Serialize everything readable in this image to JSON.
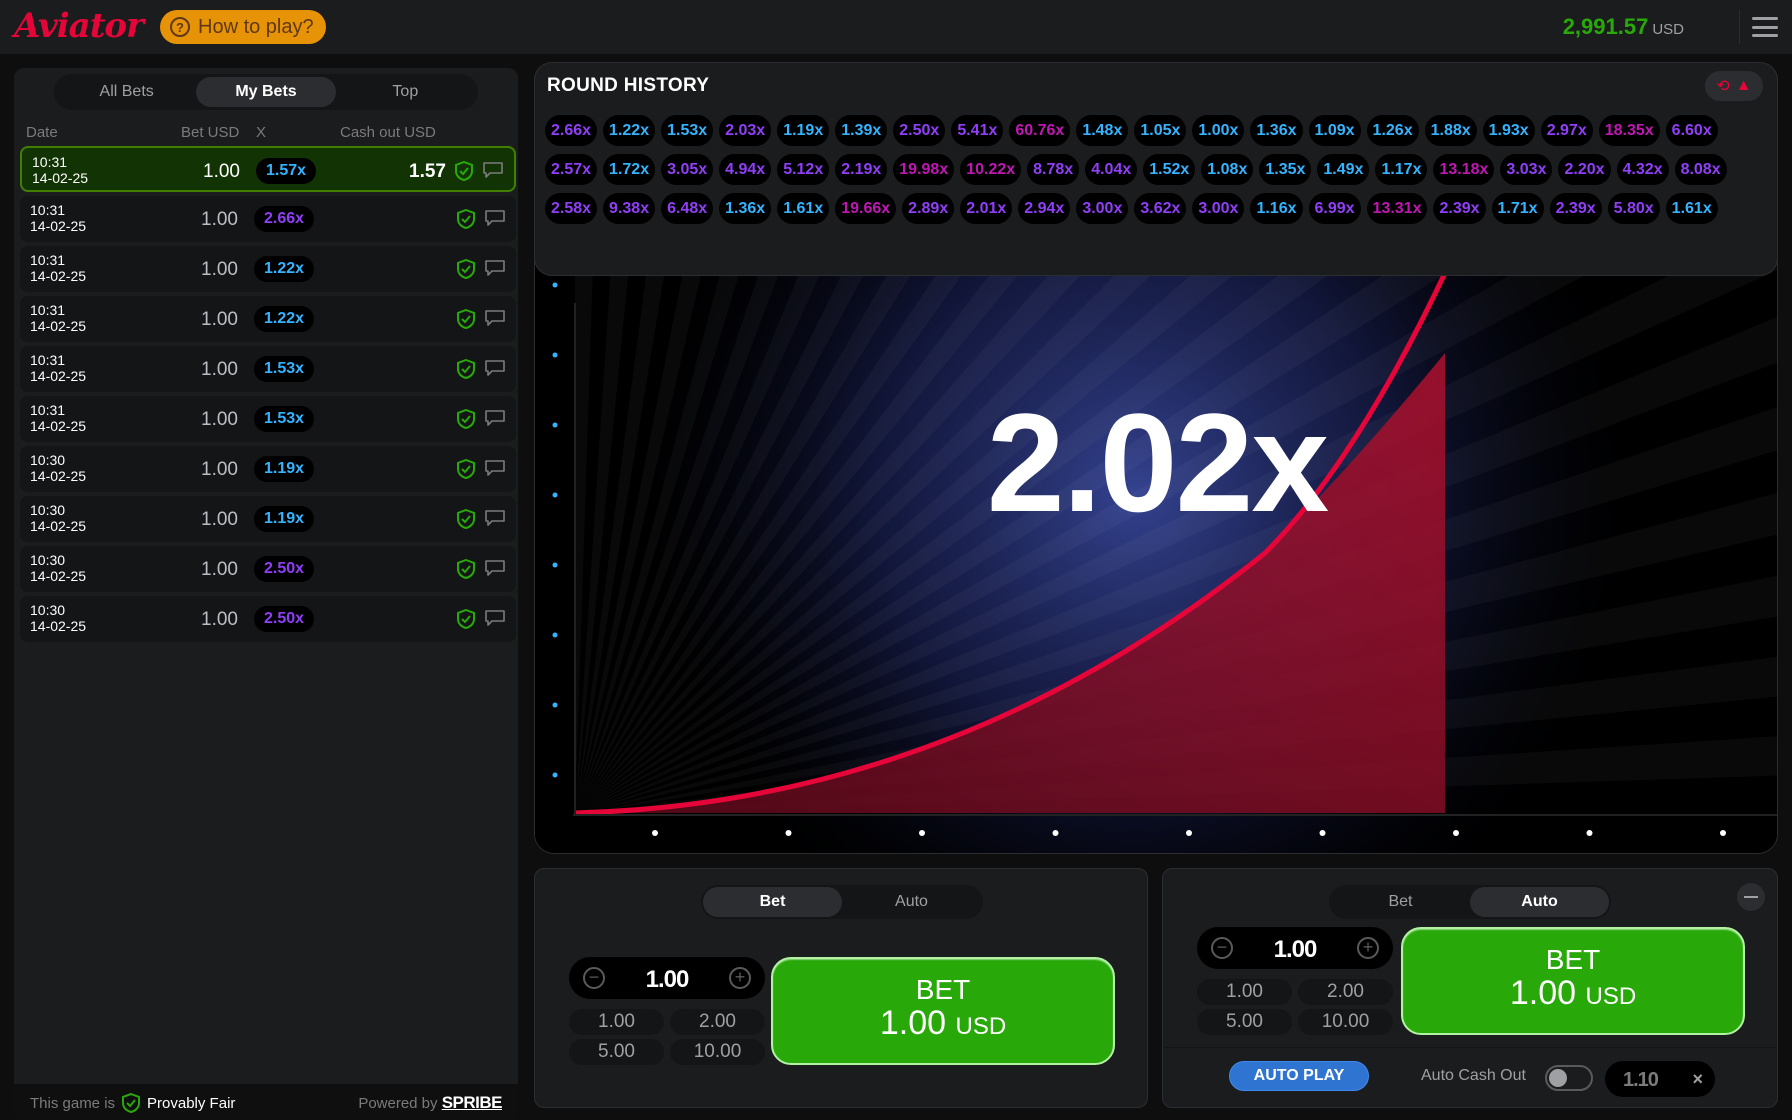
{
  "header": {
    "logo": "Aviator",
    "how_to_play": "How to play?",
    "balance_value": "2,991.57",
    "balance_currency": "USD"
  },
  "bets_panel": {
    "tabs": [
      {
        "label": "All Bets",
        "active": false
      },
      {
        "label": "My Bets",
        "active": true
      },
      {
        "label": "Top",
        "active": false
      }
    ],
    "columns": {
      "date": "Date",
      "bet": "Bet USD",
      "x": "X",
      "cashout": "Cash out USD"
    },
    "rows": [
      {
        "time": "10:31",
        "date": "14-02-25",
        "bet": "1.00",
        "mult": "1.57x",
        "mult_color": "blue",
        "cashout": "1.57",
        "win": true
      },
      {
        "time": "10:31",
        "date": "14-02-25",
        "bet": "1.00",
        "mult": "2.66x",
        "mult_color": "purple",
        "cashout": "",
        "win": false
      },
      {
        "time": "10:31",
        "date": "14-02-25",
        "bet": "1.00",
        "mult": "1.22x",
        "mult_color": "blue",
        "cashout": "",
        "win": false
      },
      {
        "time": "10:31",
        "date": "14-02-25",
        "bet": "1.00",
        "mult": "1.22x",
        "mult_color": "blue",
        "cashout": "",
        "win": false
      },
      {
        "time": "10:31",
        "date": "14-02-25",
        "bet": "1.00",
        "mult": "1.53x",
        "mult_color": "blue",
        "cashout": "",
        "win": false
      },
      {
        "time": "10:31",
        "date": "14-02-25",
        "bet": "1.00",
        "mult": "1.53x",
        "mult_color": "blue",
        "cashout": "",
        "win": false
      },
      {
        "time": "10:30",
        "date": "14-02-25",
        "bet": "1.00",
        "mult": "1.19x",
        "mult_color": "blue",
        "cashout": "",
        "win": false
      },
      {
        "time": "10:30",
        "date": "14-02-25",
        "bet": "1.00",
        "mult": "1.19x",
        "mult_color": "blue",
        "cashout": "",
        "win": false
      },
      {
        "time": "10:30",
        "date": "14-02-25",
        "bet": "1.00",
        "mult": "2.50x",
        "mult_color": "purple",
        "cashout": "",
        "win": false
      },
      {
        "time": "10:30",
        "date": "14-02-25",
        "bet": "1.00",
        "mult": "2.50x",
        "mult_color": "purple",
        "cashout": "",
        "win": false
      }
    ],
    "footer": {
      "prefix": "This game is",
      "provably_fair": "Provably Fair",
      "powered_by": "Powered by",
      "provider": "SPRIBE"
    }
  },
  "round_history": {
    "title": "ROUND HISTORY",
    "values": [
      "2.66x",
      "1.22x",
      "1.53x",
      "2.03x",
      "1.19x",
      "1.39x",
      "2.50x",
      "5.41x",
      "60.76x",
      "1.48x",
      "1.05x",
      "1.00x",
      "1.36x",
      "1.09x",
      "1.26x",
      "1.88x",
      "1.93x",
      "2.97x",
      "18.35x",
      "6.60x",
      "2.57x",
      "1.72x",
      "3.05x",
      "4.94x",
      "5.12x",
      "2.19x",
      "19.98x",
      "10.22x",
      "8.78x",
      "4.04x",
      "1.52x",
      "1.08x",
      "1.35x",
      "1.49x",
      "1.17x",
      "13.18x",
      "3.03x",
      "2.20x",
      "4.32x",
      "8.08x",
      "2.58x",
      "9.38x",
      "6.48x",
      "1.36x",
      "1.61x",
      "19.66x",
      "2.89x",
      "2.01x",
      "2.94x",
      "3.00x",
      "3.62x",
      "3.00x",
      "1.16x",
      "6.99x",
      "13.31x",
      "2.39x",
      "1.71x",
      "2.39x",
      "5.80x",
      "1.61x"
    ]
  },
  "game": {
    "multiplier": "2.02x",
    "accent_color": "#e50539"
  },
  "bet_panel_1": {
    "tabs": [
      {
        "label": "Bet",
        "active": true
      },
      {
        "label": "Auto",
        "active": false
      }
    ],
    "amount": "1.00",
    "quick": [
      "1.00",
      "2.00",
      "5.00",
      "10.00"
    ],
    "bet_label": "BET",
    "bet_amount": "1.00",
    "bet_currency": "USD"
  },
  "bet_panel_2": {
    "tabs": [
      {
        "label": "Bet",
        "active": false
      },
      {
        "label": "Auto",
        "active": true
      }
    ],
    "amount": "1.00",
    "quick": [
      "1.00",
      "2.00",
      "5.00",
      "10.00"
    ],
    "bet_label": "BET",
    "bet_amount": "1.00",
    "bet_currency": "USD",
    "auto_play": "AUTO PLAY",
    "auto_cash_out_label": "Auto Cash Out",
    "auto_cash_out_value": "1.10",
    "auto_cash_out_enabled": false
  },
  "colors": {
    "win_green": "#28a909",
    "mult_blue": "#34b4ff",
    "mult_purple": "#913ef8",
    "mult_pink": "#c017b4"
  }
}
